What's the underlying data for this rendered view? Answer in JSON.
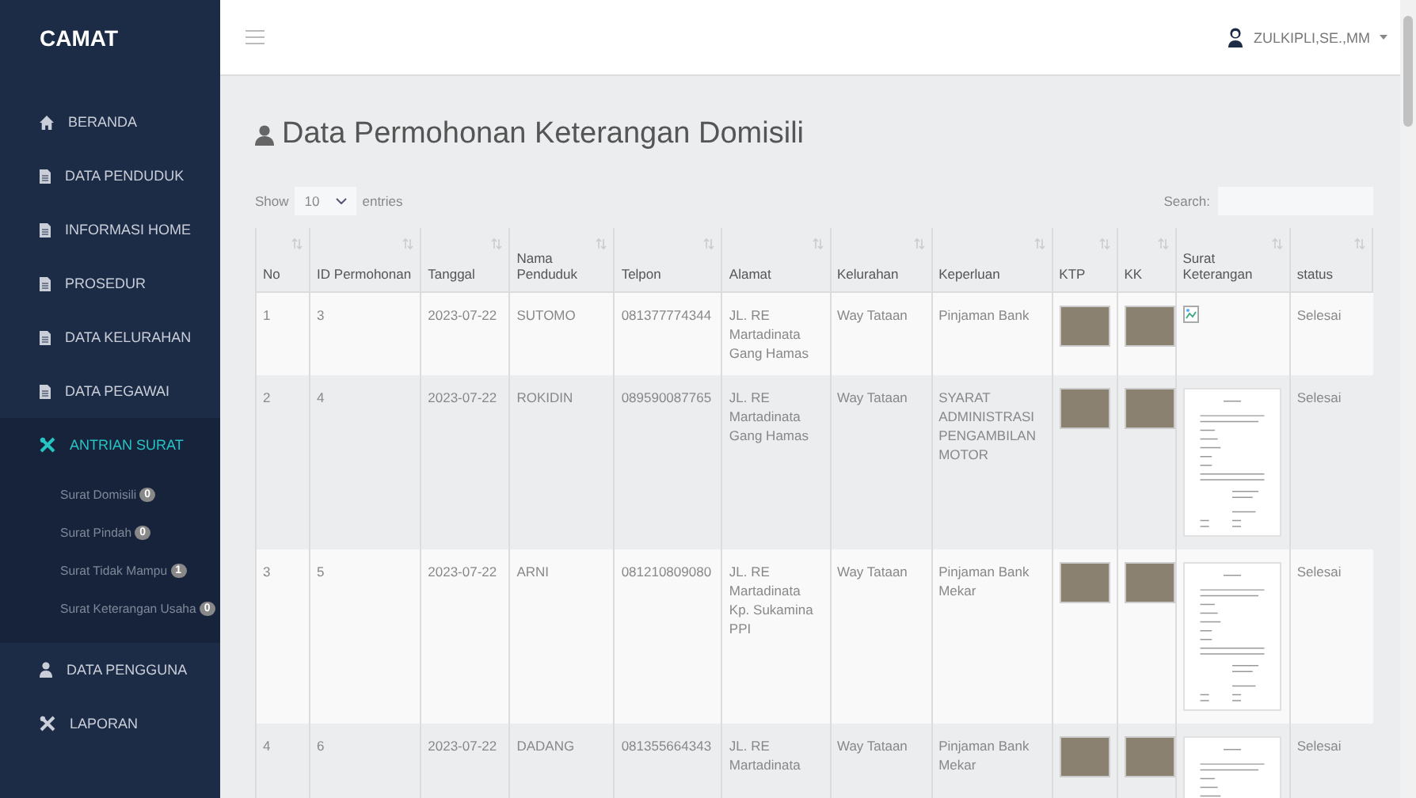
{
  "sidebar": {
    "brand": "CAMAT",
    "items": [
      {
        "label": "BERANDA",
        "selected": false
      },
      {
        "label": "DATA PENDUDUK",
        "selected": false
      },
      {
        "label": "INFORMASI HOME",
        "selected": false
      },
      {
        "label": "PROSEDUR",
        "selected": false
      },
      {
        "label": "DATA KELURAHAN",
        "selected": false
      },
      {
        "label": "DATA PEGAWAI",
        "selected": false
      },
      {
        "label": "ANTRIAN SURAT",
        "selected": true,
        "children": [
          {
            "label": "Surat Domisili",
            "badge": "0"
          },
          {
            "label": "Surat Pindah",
            "badge": "0"
          },
          {
            "label": "Surat Tidak Mampu",
            "badge": "1"
          },
          {
            "label": "Surat Keterangan Usaha",
            "badge": "0"
          }
        ]
      },
      {
        "label": "DATA PENGGUNA",
        "selected": false
      },
      {
        "label": "LAPORAN",
        "selected": false
      }
    ]
  },
  "topbar": {
    "user": "ZULKIPLI,SE.,MM"
  },
  "page": {
    "title": "Data Permohonan Keterangan Domisili"
  },
  "table_controls": {
    "show_label": "Show",
    "entries_value": "10",
    "entries_label": "entries",
    "search_label": "Search:"
  },
  "table": {
    "columns": [
      "No",
      "ID Permohonan",
      "Tanggal",
      "Nama Penduduk",
      "Telpon",
      "Alamat",
      "Kelurahan",
      "Keperluan",
      "KTP",
      "KK",
      "Surat Keterangan",
      "status"
    ],
    "rows": [
      {
        "no": "1",
        "id": "3",
        "tanggal": "2023-07-22",
        "nama": "SUTOMO",
        "telpon": "081377774344",
        "alamat": "JL. RE Martadinata Gang Hamas",
        "kelurahan": "Way Tataan",
        "keperluan": "Pinjaman Bank",
        "kind": "broken-image",
        "status": "Selesai"
      },
      {
        "no": "2",
        "id": "4",
        "tanggal": "2023-07-22",
        "nama": "ROKIDIN",
        "telpon": "089590087765",
        "alamat": "JL. RE Martadinata Gang Hamas",
        "kelurahan": "Way Tataan",
        "keperluan": "SYARAT ADMINISTRASI PENGAMBILAN MOTOR",
        "kind": "document",
        "status": "Selesai"
      },
      {
        "no": "3",
        "id": "5",
        "tanggal": "2023-07-22",
        "nama": "ARNI",
        "telpon": "081210809080",
        "alamat": "JL. RE Martadinata Kp. Sukamina PPI",
        "kelurahan": "Way Tataan",
        "keperluan": "Pinjaman Bank Mekar",
        "kind": "document",
        "status": "Selesai"
      },
      {
        "no": "4",
        "id": "6",
        "tanggal": "2023-07-22",
        "nama": "DADANG",
        "telpon": "081355664343",
        "alamat": "JL. RE Martadinata",
        "kelurahan": "Way Tataan",
        "keperluan": "Pinjaman Bank Mekar",
        "kind": "document",
        "status": "Selesai"
      }
    ]
  }
}
